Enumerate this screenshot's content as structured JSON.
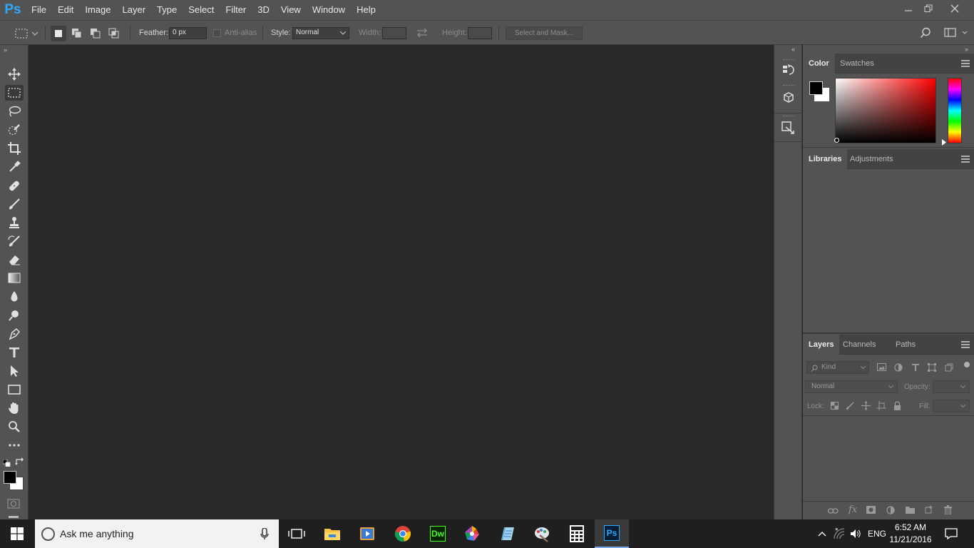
{
  "app": {
    "logo": "Ps"
  },
  "menu": [
    "File",
    "Edit",
    "Image",
    "Layer",
    "Type",
    "Select",
    "Filter",
    "3D",
    "View",
    "Window",
    "Help"
  ],
  "window_controls": {
    "minimize": "minimize-icon",
    "restore": "restore-icon",
    "close": "close-icon"
  },
  "options": {
    "feather_label": "Feather:",
    "feather_value": "0 px",
    "antialias_label": "Anti-alias",
    "style_label": "Style:",
    "style_value": "Normal",
    "width_label": "Width:",
    "height_label": "Height:",
    "select_mask_label": "Select and Mask..."
  },
  "tools": [
    "move-tool",
    "rectangular-marquee-tool",
    "lasso-tool",
    "quick-selection-tool",
    "crop-tool",
    "eyedropper-tool",
    "healing-brush-tool",
    "brush-tool",
    "clone-stamp-tool",
    "history-brush-tool",
    "eraser-tool",
    "gradient-tool",
    "blur-tool",
    "dodge-tool",
    "pen-tool",
    "type-tool",
    "path-selection-tool",
    "rectangle-tool",
    "hand-tool",
    "zoom-tool",
    "edit-toolbar"
  ],
  "colors": {
    "foreground": "#000000",
    "background": "#ffffff",
    "ui": "#535353",
    "canvas": "#282828",
    "accent": "#31a8ff"
  },
  "color_panel": {
    "tabs": [
      "Color",
      "Swatches"
    ]
  },
  "libraries_panel": {
    "tabs": [
      "Libraries",
      "Adjustments"
    ]
  },
  "layers_panel": {
    "tabs": [
      "Layers",
      "Channels",
      "Paths"
    ],
    "filter_placeholder": "Kind",
    "blend_mode": "Normal",
    "opacity_label": "Opacity:",
    "lock_label": "Lock:",
    "fill_label": "Fill:"
  },
  "taskbar": {
    "search_placeholder": "Ask me anything",
    "apps": [
      "task-view",
      "file-explorer",
      "media-player",
      "chrome",
      "dreamweaver",
      "picasa",
      "notepad",
      "paint",
      "calculator",
      "photoshop"
    ],
    "photoshop_label": "Ps",
    "dreamweaver_label": "Dw",
    "language": "ENG",
    "time": "6:52 AM",
    "date": "11/21/2016"
  }
}
